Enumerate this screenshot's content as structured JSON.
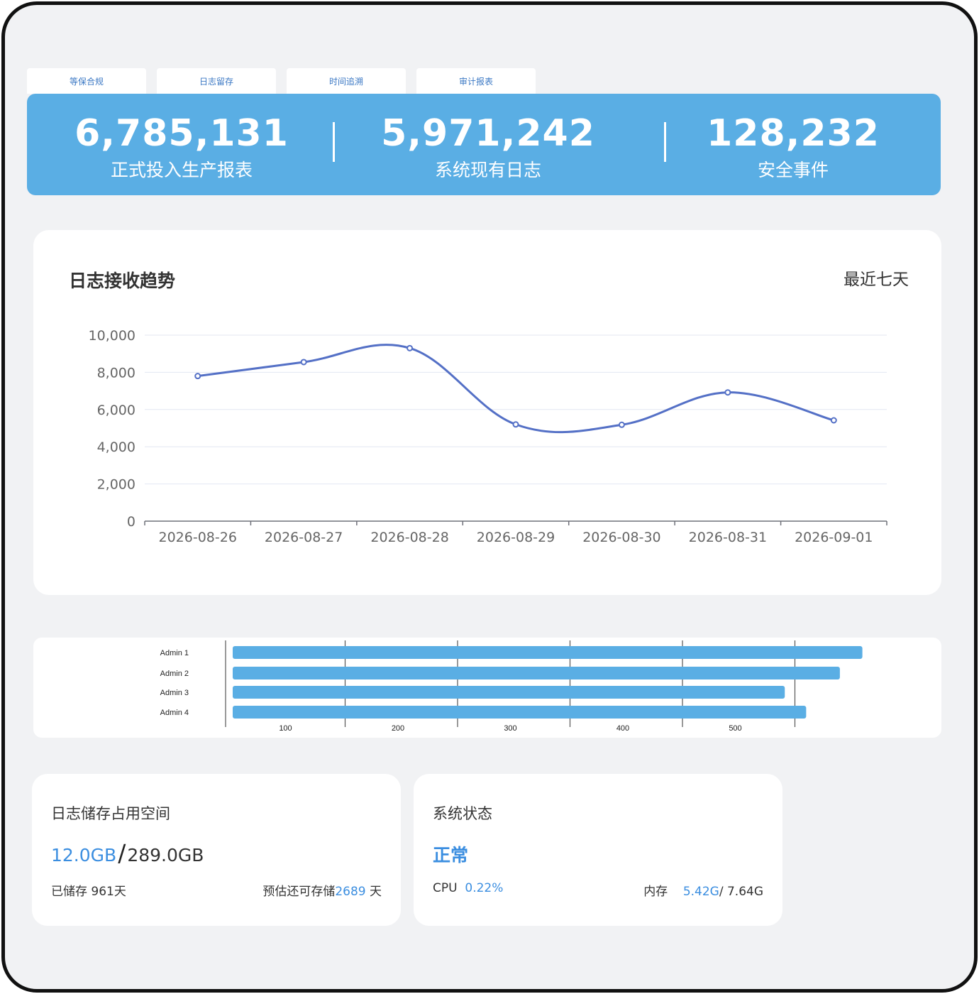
{
  "tabs": [
    "等保合规",
    "日志留存",
    "时间追溯",
    "审计报表"
  ],
  "stats": [
    {
      "value": "6,785,131",
      "label": "正式投入生产报表"
    },
    {
      "value": "5,971,242",
      "label": "系统现有日志"
    },
    {
      "value": "128,232",
      "label": "安全事件"
    }
  ],
  "trend": {
    "title": "日志接收趋势",
    "range_label": "最近七天"
  },
  "storage": {
    "title": "日志储存占用空间",
    "used": "12.0GB",
    "separator": "/",
    "total": "289.0GB",
    "stored_label": "已储存 961天",
    "remaining_prefix": "预估还可存储",
    "remaining_days": "2689",
    "remaining_suffix": " 天"
  },
  "system": {
    "title": "系统状态",
    "status": "正常",
    "cpu_label": "CPU",
    "cpu_value": "0.22%",
    "mem_label": "内存",
    "mem_used": "5.42G",
    "mem_total": "/ 7.64G"
  },
  "colors": {
    "banner": "#5aaee4",
    "line": "#5470c6",
    "bar": "#5aaee4",
    "accent": "#3b8ee0"
  },
  "chart_data": [
    {
      "type": "line",
      "x": [
        "2026-08-26",
        "2026-08-27",
        "2026-08-28",
        "2026-08-29",
        "2026-08-30",
        "2026-08-31",
        "2026-09-01"
      ],
      "series": [
        {
          "values": [
            7800,
            8550,
            9300,
            5200,
            5180,
            6920,
            5420
          ]
        }
      ],
      "ylim": [
        0,
        10000
      ],
      "yticks": [
        "0",
        "2,000",
        "4,000",
        "6,000",
        "8,000",
        "10,000"
      ],
      "smooth": true,
      "grid": true
    },
    {
      "type": "bar",
      "orientation": "horizontal",
      "categories": [
        "Admin 1",
        "Admin 2",
        "Admin 3",
        "Admin 4"
      ],
      "values": [
        560,
        540,
        491,
        510
      ],
      "xticks": [
        "100",
        "200",
        "300",
        "400",
        "500"
      ],
      "grid": true
    }
  ]
}
